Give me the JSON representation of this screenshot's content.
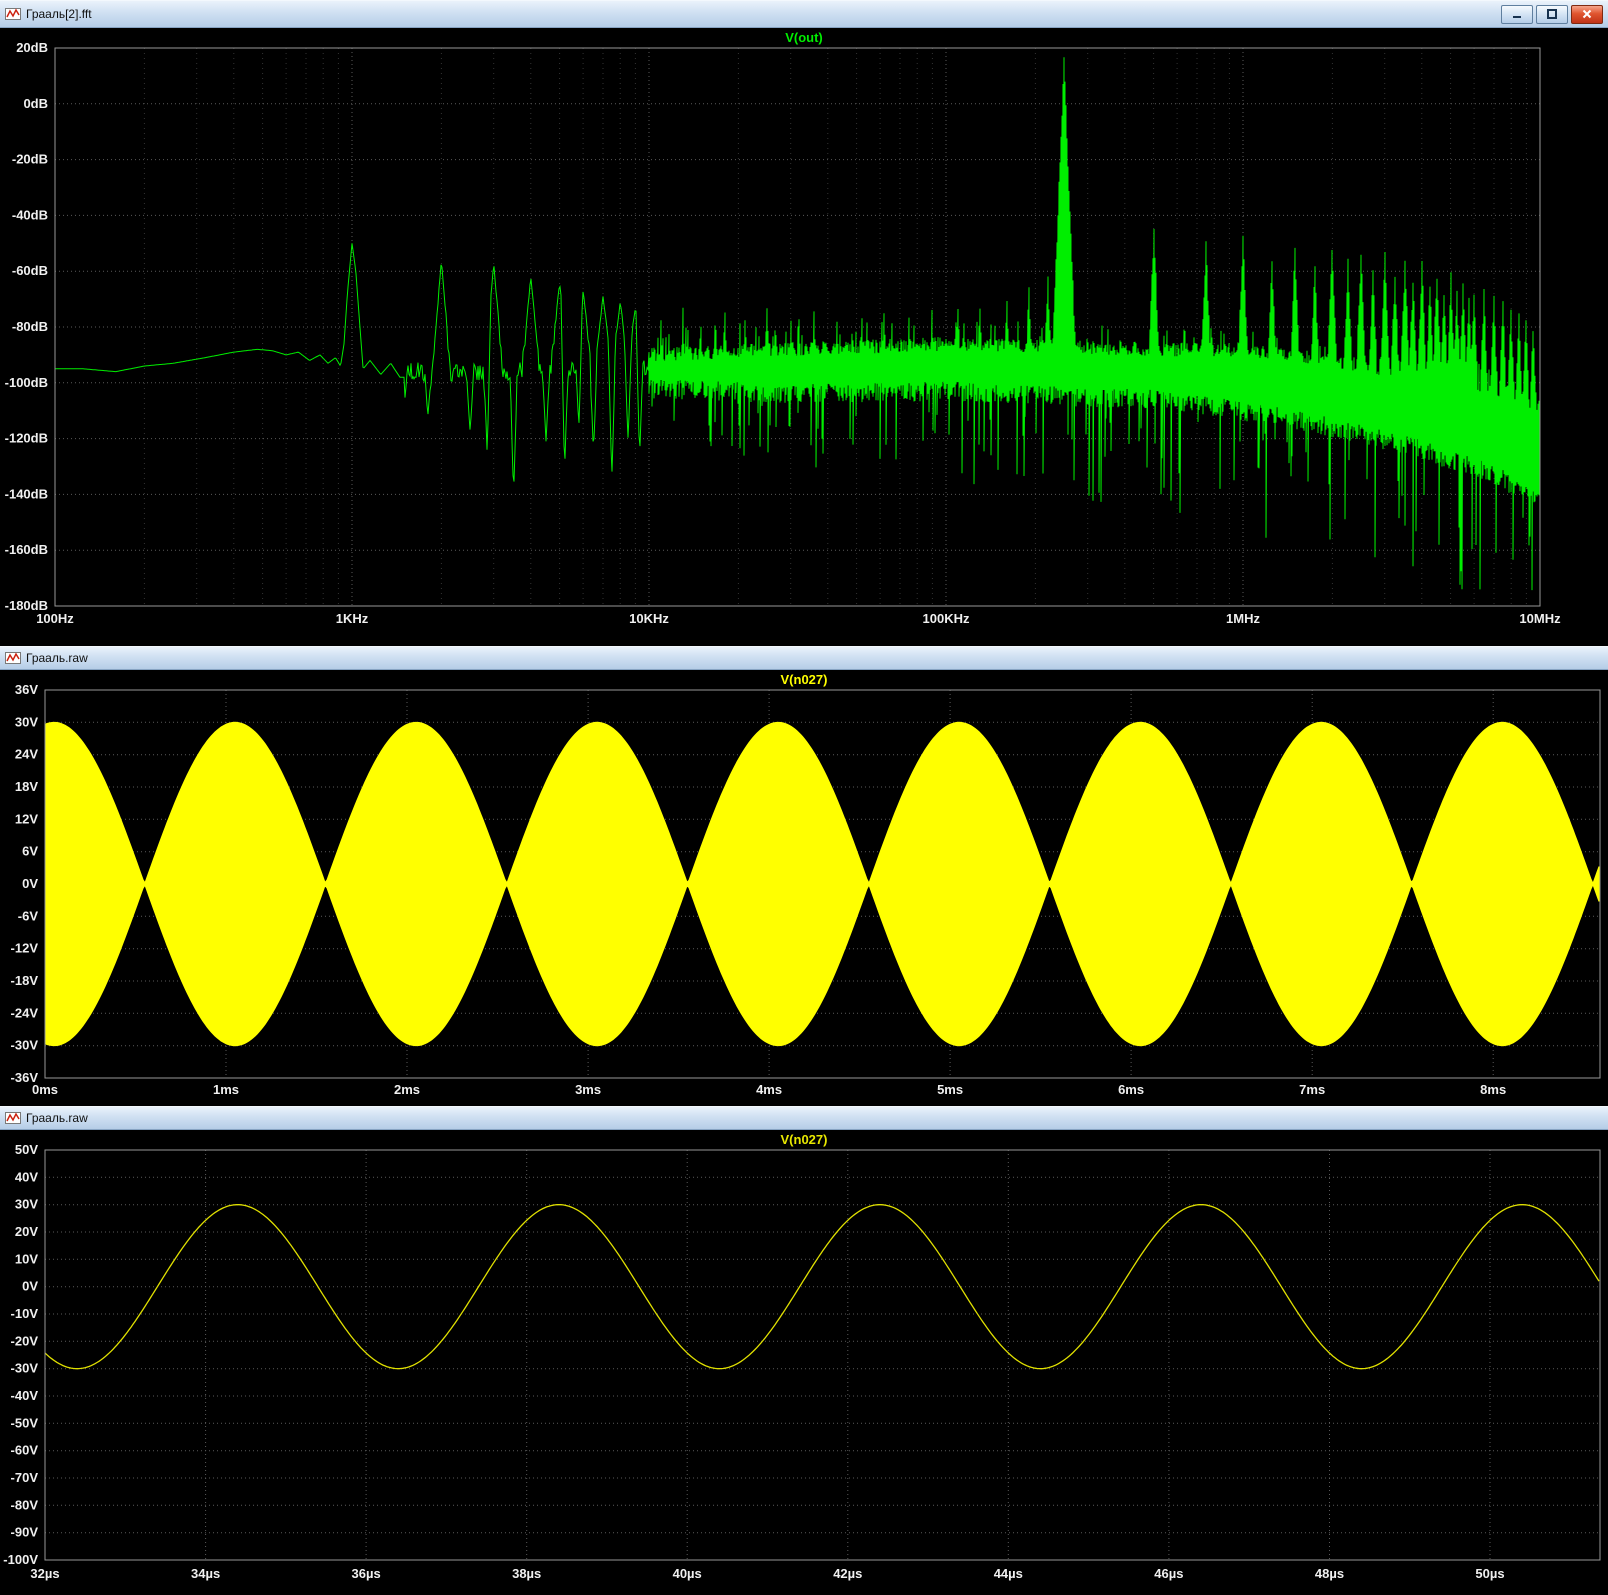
{
  "windows": [
    {
      "title": "Грааль[2].fft"
    },
    {
      "title": "Грааль.raw"
    },
    {
      "title": "Грааль.raw"
    }
  ],
  "icons": {
    "titlebar": "waveform-icon",
    "minimize": "minimize-icon",
    "maximize": "maximize-icon",
    "close": "close-icon"
  },
  "colors": {
    "plot_background": "#000000",
    "grid_major": "#5a5a5a",
    "grid_minor": "#333333",
    "frame": "#989898",
    "tick_text": "#f0f0f0",
    "fft_trace": "#00ee00",
    "am_trace": "#ffff00",
    "sine_trace": "#d8d800"
  },
  "chart_data": [
    {
      "type": "line",
      "title": "V(out)",
      "color": "#00ee00",
      "x_scale": "log",
      "x_range_hz": [
        100,
        10000000
      ],
      "y_range_db": [
        -180,
        20
      ],
      "x_ticks": [
        {
          "f": 100,
          "label": "100Hz"
        },
        {
          "f": 1000,
          "label": "1KHz"
        },
        {
          "f": 10000,
          "label": "10KHz"
        },
        {
          "f": 100000,
          "label": "100KHz"
        },
        {
          "f": 1000000,
          "label": "1MHz"
        },
        {
          "f": 10000000,
          "label": "10MHz"
        }
      ],
      "y_ticks": [
        {
          "v": 20,
          "label": "20dB"
        },
        {
          "v": 0,
          "label": "0dB"
        },
        {
          "v": -20,
          "label": "-20dB"
        },
        {
          "v": -40,
          "label": "-40dB"
        },
        {
          "v": -60,
          "label": "-60dB"
        },
        {
          "v": -80,
          "label": "-80dB"
        },
        {
          "v": -100,
          "label": "-100dB"
        },
        {
          "v": -120,
          "label": "-120dB"
        },
        {
          "v": -140,
          "label": "-140dB"
        },
        {
          "v": -160,
          "label": "-160dB"
        },
        {
          "v": -180,
          "label": "-180dB"
        }
      ],
      "noise_floor": [
        [
          100,
          -95
        ],
        [
          125,
          -95
        ],
        [
          160,
          -96
        ],
        [
          200,
          -94
        ],
        [
          250,
          -93
        ],
        [
          320,
          -91
        ],
        [
          400,
          -89
        ],
        [
          480,
          -88
        ],
        [
          540,
          -88.5
        ],
        [
          600,
          -90
        ],
        [
          660,
          -89
        ],
        [
          720,
          -92
        ],
        [
          780,
          -90
        ],
        [
          830,
          -93
        ],
        [
          880,
          -91
        ],
        [
          915,
          -94
        ],
        [
          940,
          -86
        ],
        [
          965,
          -68
        ],
        [
          1000,
          -50
        ],
        [
          1030,
          -60
        ],
        [
          1060,
          -78
        ],
        [
          1090,
          -95
        ],
        [
          1150,
          -92
        ],
        [
          1250,
          -97
        ],
        [
          1350,
          -93
        ],
        [
          1450,
          -98
        ]
      ],
      "low_harmonics": [
        [
          2000,
          -56
        ],
        [
          3000,
          -57
        ],
        [
          4000,
          -62
        ],
        [
          5000,
          -64
        ],
        [
          6000,
          -67
        ],
        [
          7000,
          -69
        ],
        [
          8000,
          -71
        ],
        [
          9000,
          -73
        ]
      ],
      "nulls": [
        [
          1500,
          -107
        ],
        [
          1800,
          -112
        ],
        [
          2500,
          -118
        ],
        [
          2850,
          -125
        ],
        [
          3500,
          -141
        ],
        [
          4500,
          -121
        ],
        [
          5200,
          -132
        ],
        [
          5800,
          -117
        ],
        [
          6500,
          -124
        ],
        [
          7500,
          -133
        ],
        [
          8500,
          -120
        ],
        [
          9300,
          -127
        ]
      ],
      "band_top": [
        [
          10000,
          -90
        ],
        [
          30000,
          -88
        ],
        [
          100000,
          -86
        ],
        [
          250000,
          -87
        ],
        [
          500000,
          -88
        ],
        [
          1000000,
          -88
        ],
        [
          2000000,
          -92
        ],
        [
          4000000,
          -97
        ],
        [
          7000000,
          -103
        ],
        [
          10000000,
          -110
        ]
      ],
      "band_bottom": [
        [
          10000,
          -102
        ],
        [
          30000,
          -104
        ],
        [
          100000,
          -103
        ],
        [
          250000,
          -105
        ],
        [
          500000,
          -106
        ],
        [
          1000000,
          -110
        ],
        [
          2000000,
          -116
        ],
        [
          4000000,
          -124
        ],
        [
          7000000,
          -133
        ],
        [
          10000000,
          -142
        ]
      ],
      "extra_spikes": [
        [
          11000,
          -76
        ],
        [
          13000,
          -73
        ],
        [
          15000,
          -75
        ],
        [
          18000,
          -71
        ],
        [
          21000,
          -74
        ],
        [
          25000,
          -72
        ],
        [
          30000,
          -75
        ],
        [
          36000,
          -73
        ],
        [
          43000,
          -76
        ],
        [
          52000,
          -74
        ],
        [
          62000,
          -72
        ],
        [
          75000,
          -75
        ],
        [
          90000,
          -73
        ],
        [
          110000,
          -71
        ],
        [
          130000,
          -69
        ],
        [
          160000,
          -67
        ],
        [
          190000,
          -64
        ],
        [
          220000,
          -60
        ]
      ],
      "carrier_harmonics": [
        [
          250000,
          18
        ],
        [
          500000,
          -42
        ],
        [
          750000,
          -48
        ],
        [
          1000000,
          -45
        ],
        [
          1250000,
          -54
        ],
        [
          1500000,
          -50
        ],
        [
          1750000,
          -56
        ],
        [
          2000000,
          -49
        ],
        [
          2250000,
          -55
        ],
        [
          2500000,
          -51
        ],
        [
          2750000,
          -57
        ],
        [
          3000000,
          -52
        ],
        [
          3250000,
          -58
        ],
        [
          3500000,
          -54
        ],
        [
          3750000,
          -60
        ],
        [
          4000000,
          -56
        ],
        [
          4250000,
          -62
        ],
        [
          4500000,
          -58
        ],
        [
          4750000,
          -64
        ],
        [
          5000000,
          -60
        ],
        [
          5250000,
          -66
        ],
        [
          5500000,
          -62
        ],
        [
          5750000,
          -68
        ],
        [
          6000000,
          -64
        ],
        [
          6500000,
          -66
        ],
        [
          7000000,
          -68
        ],
        [
          7500000,
          -70
        ],
        [
          8000000,
          -72
        ],
        [
          8500000,
          -74
        ],
        [
          9000000,
          -76
        ],
        [
          9500000,
          -78
        ]
      ]
    },
    {
      "type": "line",
      "title": "V(n027)",
      "color": "#ffff00",
      "fill": true,
      "x_range_ms": [
        0,
        8.59
      ],
      "y_range_v": [
        -36,
        36
      ],
      "x_ticks": [
        {
          "v": 0,
          "label": "0ms"
        },
        {
          "v": 1,
          "label": "1ms"
        },
        {
          "v": 2,
          "label": "2ms"
        },
        {
          "v": 3,
          "label": "3ms"
        },
        {
          "v": 4,
          "label": "4ms"
        },
        {
          "v": 5,
          "label": "5ms"
        },
        {
          "v": 6,
          "label": "6ms"
        },
        {
          "v": 7,
          "label": "7ms"
        },
        {
          "v": 8,
          "label": "8ms"
        }
      ],
      "y_ticks": [
        {
          "v": 36,
          "label": "36V"
        },
        {
          "v": 30,
          "label": "30V"
        },
        {
          "v": 24,
          "label": "24V"
        },
        {
          "v": 18,
          "label": "18V"
        },
        {
          "v": 12,
          "label": "12V"
        },
        {
          "v": 6,
          "label": "6V"
        },
        {
          "v": 0,
          "label": "0V"
        },
        {
          "v": -6,
          "label": "-6V"
        },
        {
          "v": -12,
          "label": "-12V"
        },
        {
          "v": -18,
          "label": "-18V"
        },
        {
          "v": -24,
          "label": "-24V"
        },
        {
          "v": -30,
          "label": "-30V"
        },
        {
          "v": -36,
          "label": "-36V"
        }
      ],
      "signal": {
        "kind": "am_beats",
        "envelope_amplitude_v": 30,
        "envelope_period_ms": 1.0,
        "envelope_peak_at_ms": 0.05,
        "carrier_khz": 250,
        "rendering": "solid fill between +envelope and -envelope"
      }
    },
    {
      "type": "line",
      "title": "V(n027)",
      "color": "#d8d800",
      "x_range_us": [
        32,
        51.37
      ],
      "y_range_v": [
        -100,
        50
      ],
      "x_ticks": [
        {
          "v": 32,
          "label": "32µs"
        },
        {
          "v": 34,
          "label": "34µs"
        },
        {
          "v": 36,
          "label": "36µs"
        },
        {
          "v": 38,
          "label": "38µs"
        },
        {
          "v": 40,
          "label": "40µs"
        },
        {
          "v": 42,
          "label": "42µs"
        },
        {
          "v": 44,
          "label": "44µs"
        },
        {
          "v": 46,
          "label": "46µs"
        },
        {
          "v": 48,
          "label": "48µs"
        },
        {
          "v": 50,
          "label": "50µs"
        }
      ],
      "y_ticks": [
        {
          "v": 50,
          "label": "50V"
        },
        {
          "v": 40,
          "label": "40V"
        },
        {
          "v": 30,
          "label": "30V"
        },
        {
          "v": 20,
          "label": "20V"
        },
        {
          "v": 10,
          "label": "10V"
        },
        {
          "v": 0,
          "label": "0V"
        },
        {
          "v": -10,
          "label": "-10V"
        },
        {
          "v": -20,
          "label": "-20V"
        },
        {
          "v": -30,
          "label": "-30V"
        },
        {
          "v": -40,
          "label": "-40V"
        },
        {
          "v": -50,
          "label": "-50V"
        },
        {
          "v": -60,
          "label": "-60V"
        },
        {
          "v": -70,
          "label": "-70V"
        },
        {
          "v": -80,
          "label": "-80V"
        },
        {
          "v": -90,
          "label": "-90V"
        },
        {
          "v": -100,
          "label": "-100V"
        }
      ],
      "signal": {
        "kind": "sine",
        "amplitude_v": 30,
        "period_us": 4,
        "zero_rising_crossing_us": 33.4
      }
    }
  ]
}
